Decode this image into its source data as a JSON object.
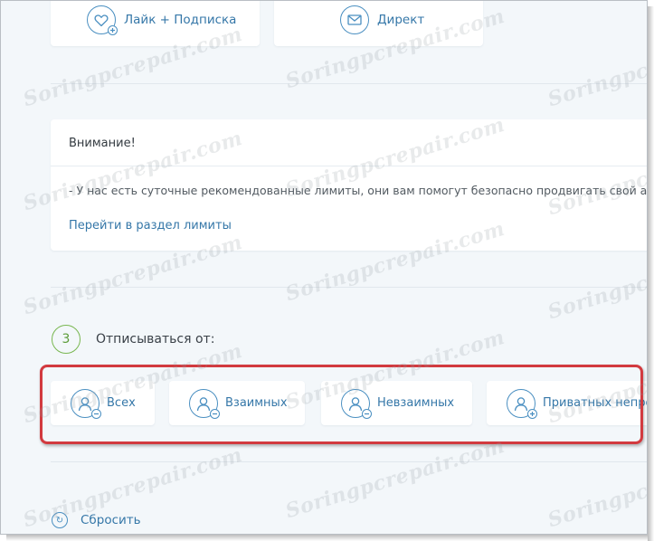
{
  "top_buttons": [
    {
      "label": "Лайк + Подписка",
      "icon": "heart-plus-icon"
    },
    {
      "label": "Директ",
      "icon": "envelope-icon"
    }
  ],
  "notice": {
    "title": "Внимание!",
    "text": "- У нас есть суточные рекомендованные лимиты, они вам помогут безопасно продвигать свой аккаунт",
    "link": "Перейти в раздел лимиты"
  },
  "step": {
    "number": "3",
    "label": "Отписываться от:"
  },
  "options": [
    {
      "label": "Всех",
      "icon": "user-minus-icon"
    },
    {
      "label": "Взаимных",
      "icon": "user-minus-icon"
    },
    {
      "label": "Невзаимных",
      "icon": "user-minus-icon"
    },
    {
      "label": "Приватных непрошедших",
      "icon": "user-plus-icon"
    }
  ],
  "reset": {
    "label": "Сбросить",
    "icon": "refresh-icon"
  },
  "watermark": "Soringpcrepair.com",
  "colors": {
    "accent": "#3577a8",
    "step_green": "#79b751",
    "highlight_red": "#d23a3f",
    "background": "#f3f7fa"
  }
}
